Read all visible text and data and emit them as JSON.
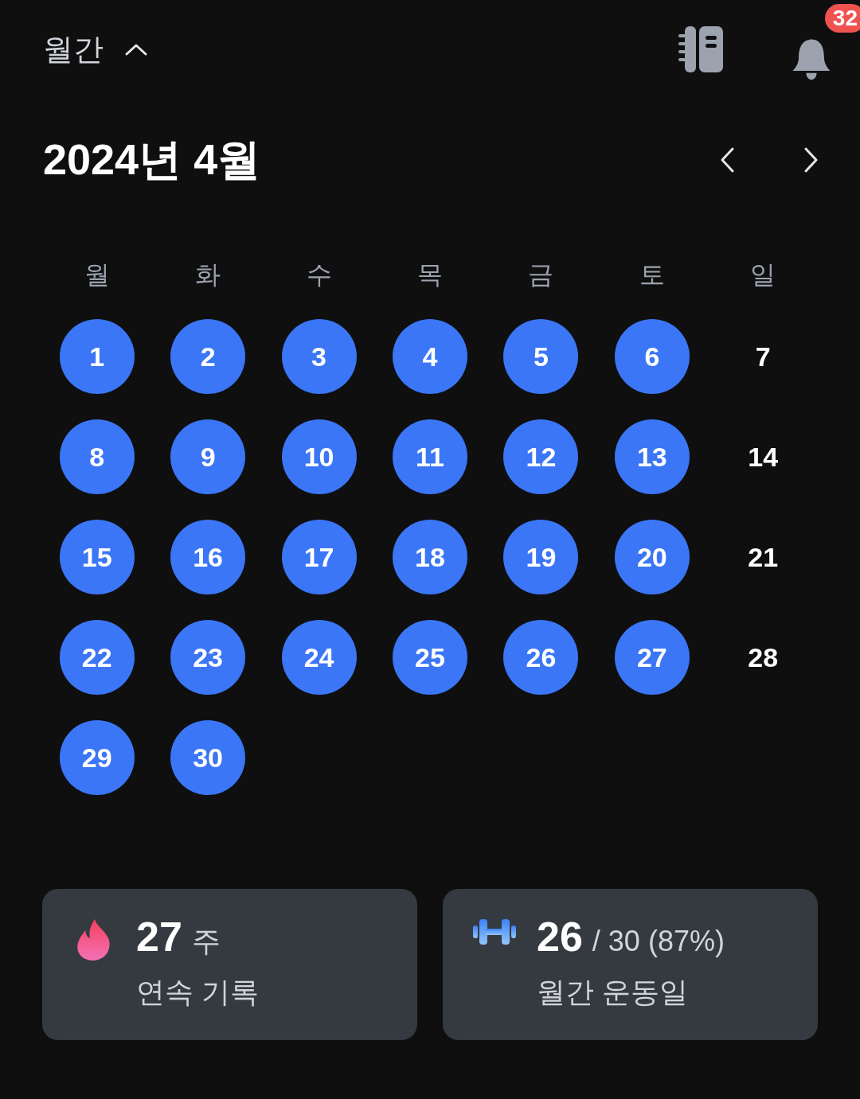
{
  "header": {
    "view_label": "월간",
    "expanded": true,
    "notification_count": "32"
  },
  "calendar": {
    "title": "2024년 4월",
    "weekdays": [
      "월",
      "화",
      "수",
      "목",
      "금",
      "토",
      "일"
    ],
    "days": [
      {
        "label": "1",
        "done": true
      },
      {
        "label": "2",
        "done": true
      },
      {
        "label": "3",
        "done": true
      },
      {
        "label": "4",
        "done": true
      },
      {
        "label": "5",
        "done": true
      },
      {
        "label": "6",
        "done": true
      },
      {
        "label": "7",
        "done": false
      },
      {
        "label": "8",
        "done": true
      },
      {
        "label": "9",
        "done": true
      },
      {
        "label": "10",
        "done": true
      },
      {
        "label": "11",
        "done": true
      },
      {
        "label": "12",
        "done": true
      },
      {
        "label": "13",
        "done": true
      },
      {
        "label": "14",
        "done": false
      },
      {
        "label": "15",
        "done": true
      },
      {
        "label": "16",
        "done": true
      },
      {
        "label": "17",
        "done": true
      },
      {
        "label": "18",
        "done": true
      },
      {
        "label": "19",
        "done": true
      },
      {
        "label": "20",
        "done": true
      },
      {
        "label": "21",
        "done": false
      },
      {
        "label": "22",
        "done": true
      },
      {
        "label": "23",
        "done": true
      },
      {
        "label": "24",
        "done": true
      },
      {
        "label": "25",
        "done": true
      },
      {
        "label": "26",
        "done": true
      },
      {
        "label": "27",
        "done": true
      },
      {
        "label": "28",
        "done": false
      },
      {
        "label": "29",
        "done": true
      },
      {
        "label": "30",
        "done": true
      }
    ]
  },
  "stats": [
    {
      "kind": "streak",
      "value": "27",
      "suffix": "주",
      "label": "연속 기록"
    },
    {
      "kind": "workout",
      "value": "26",
      "suffix": "/ 30 (87%)",
      "label": "월간 운동일"
    }
  ]
}
